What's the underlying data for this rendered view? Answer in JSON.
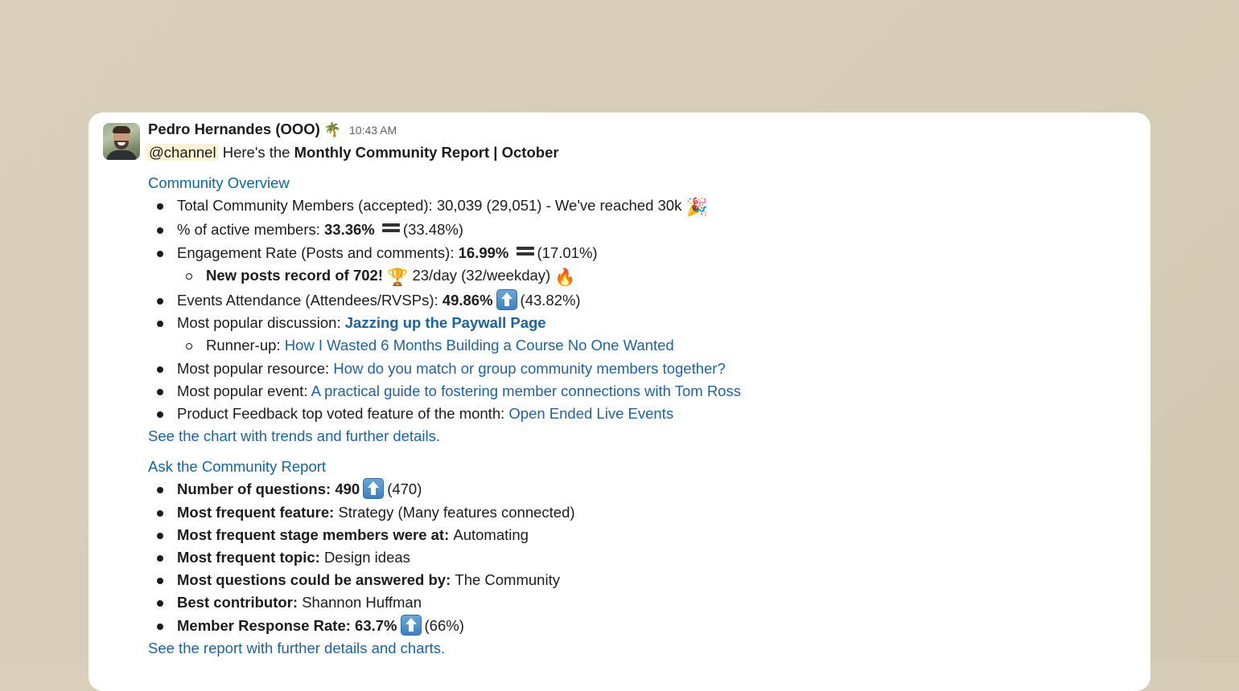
{
  "message": {
    "author": "Pedro Hernandes (OOO)",
    "status_emoji": "🌴",
    "timestamp": "10:43 AM",
    "mention": "@channel",
    "intro_text": "Here's the ",
    "intro_bold": "Monthly Community Report | October"
  },
  "community_overview": {
    "title": "Community Overview",
    "members": {
      "label": "Total Community Members (accepted): 30,039 (29,051) - We've reached 30k",
      "emoji": "🎉"
    },
    "active": {
      "label": "% of active members: ",
      "value": "33.36%",
      "trend": "equal",
      "previous": "(33.48%)"
    },
    "engagement": {
      "label": "Engagement Rate (Posts and comments): ",
      "value": "16.99%",
      "trend": "equal",
      "previous": "(17.01%)"
    },
    "posts_record": {
      "bold": "New posts record of 702!",
      "emoji1": "🏆",
      "text": " 23/day (32/weekday) ",
      "emoji2": "🔥"
    },
    "events_attendance": {
      "label": "Events Attendance (Attendees/RVSPs): ",
      "value": "49.86%",
      "trend": "up",
      "previous": "(43.82%)"
    },
    "popular_discussion": {
      "label": "Most popular discussion: ",
      "link": "Jazzing up the Paywall Page"
    },
    "runner_up": {
      "label": "Runner-up: ",
      "link": "How I Wasted 6 Months Building a Course No One Wanted"
    },
    "popular_resource": {
      "label": "Most popular resource: ",
      "link": "How do you match or group community members together?"
    },
    "popular_event": {
      "label": "Most popular event: ",
      "link": "A practical guide to fostering member connections with Tom Ross"
    },
    "product_feedback": {
      "label": "Product Feedback top voted feature of the month: ",
      "link": "Open Ended Live Events"
    },
    "footer_link": "See the chart with trends and further details."
  },
  "ask_report": {
    "title": "Ask the Community Report",
    "questions": {
      "label": "Number of questions: ",
      "value": "490",
      "trend": "up",
      "previous": "(470)"
    },
    "feature": {
      "label": "Most frequent feature: ",
      "value": "Strategy (Many features connected)"
    },
    "stage": {
      "label": "Most frequent stage members were at: ",
      "value": "Automating"
    },
    "topic": {
      "label": "Most frequent topic: ",
      "value": "Design ideas"
    },
    "answered_by": {
      "label": "Most questions could be answered by: ",
      "value": "The Community"
    },
    "contributor": {
      "label": "Best contributor: ",
      "value": "Shannon Huffman"
    },
    "response_rate": {
      "label": "Member Response Rate: ",
      "value": "63.7%",
      "trend": "up",
      "previous": "(66%)"
    },
    "footer_link": "See the report with further details and charts."
  },
  "colors": {
    "background": "#d8cebb",
    "card": "#ffffff",
    "link": "#1d63a0",
    "mention_bg": "#fdf2d3",
    "text": "#1d1c1d"
  }
}
